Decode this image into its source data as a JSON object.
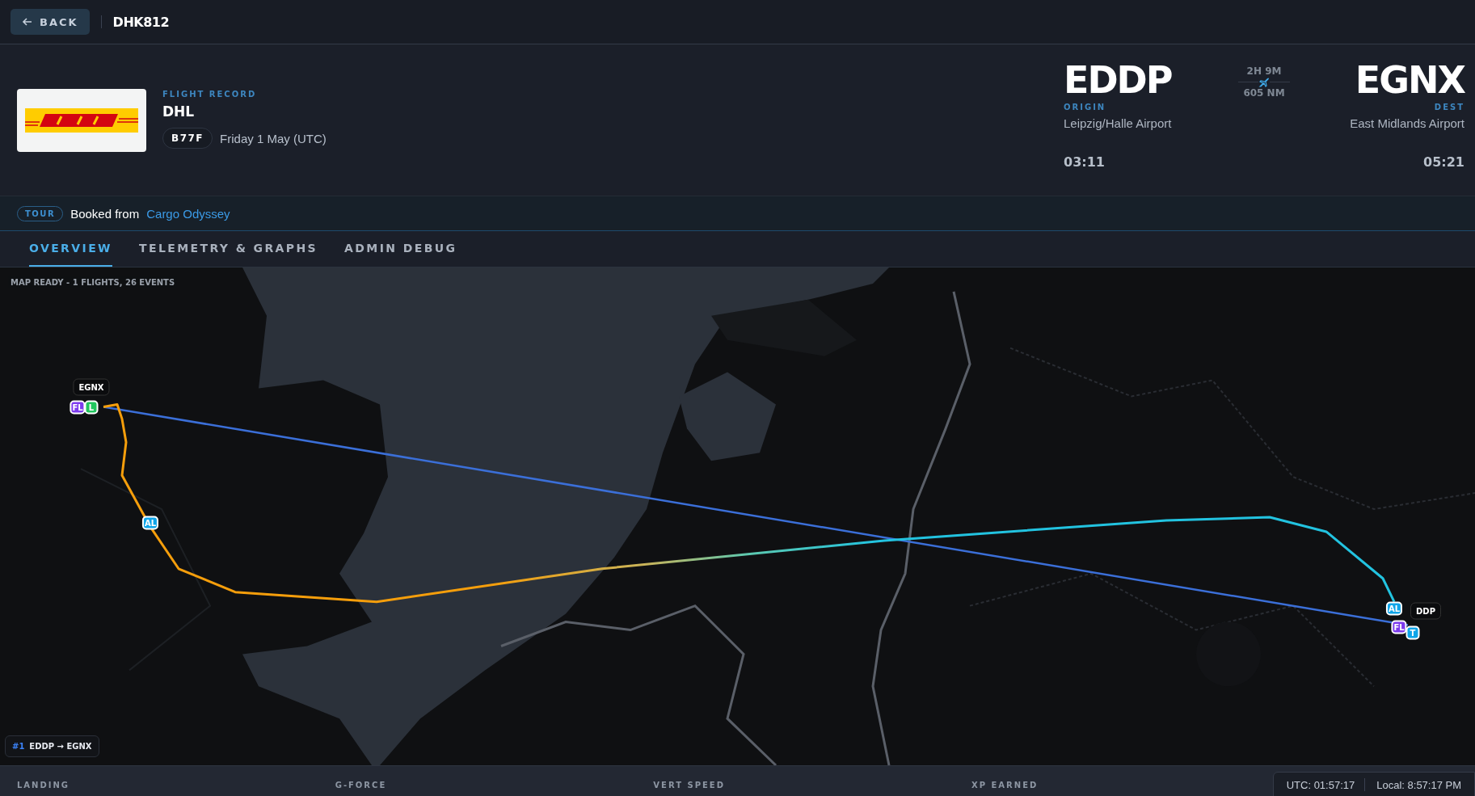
{
  "top_bar": {
    "back_label": "BACK",
    "flight_number": "DHK812"
  },
  "record": {
    "eyebrow": "FLIGHT RECORD",
    "airline": "DHL",
    "aircraft": "B77F",
    "date": "Friday 1 May (UTC)"
  },
  "route": {
    "origin": {
      "code": "EDDP",
      "role": "ORIGIN",
      "name": "Leipzig/Halle Airport",
      "time": "03:11"
    },
    "duration": "2H 9M",
    "distance": "605 NM",
    "destination": {
      "code": "EGNX",
      "role": "DEST",
      "name": "East Midlands Airport",
      "time": "05:21"
    }
  },
  "tour": {
    "badge": "TOUR",
    "text": "Booked from",
    "link": "Cargo Odyssey"
  },
  "tabs": [
    {
      "label": "OVERVIEW",
      "selected": true
    },
    {
      "label": "TELEMETRY & GRAPHS",
      "selected": false
    },
    {
      "label": "ADMIN DEBUG",
      "selected": false
    }
  ],
  "map": {
    "status": "MAP READY - 1 FLIGHTS, 26 EVENTS",
    "markers": [
      {
        "kind": "airport",
        "label": "EGNX"
      },
      {
        "kind": "event",
        "label": "FL",
        "color": "#7c3aed"
      },
      {
        "kind": "event",
        "label": "L",
        "color": "#22c55e"
      },
      {
        "kind": "event",
        "label": "AL",
        "color": "#0ea5e9"
      },
      {
        "kind": "airport",
        "label": "DDP"
      },
      {
        "kind": "event",
        "label": "FL",
        "color": "#7c3aed"
      },
      {
        "kind": "event",
        "label": "T",
        "color": "#0ea5e9"
      },
      {
        "kind": "event",
        "label": "AL",
        "color": "#0ea5e9"
      }
    ],
    "flight_chip": {
      "index": "#1",
      "route": "EDDP → EGNX"
    }
  },
  "stats": [
    {
      "label": "LANDING"
    },
    {
      "label": "G-FORCE"
    },
    {
      "label": "VERT SPEED"
    },
    {
      "label": "XP EARNED"
    }
  ],
  "clock": {
    "utc": "UTC: 01:57:17",
    "local": "Local: 8:57:17 PM"
  }
}
